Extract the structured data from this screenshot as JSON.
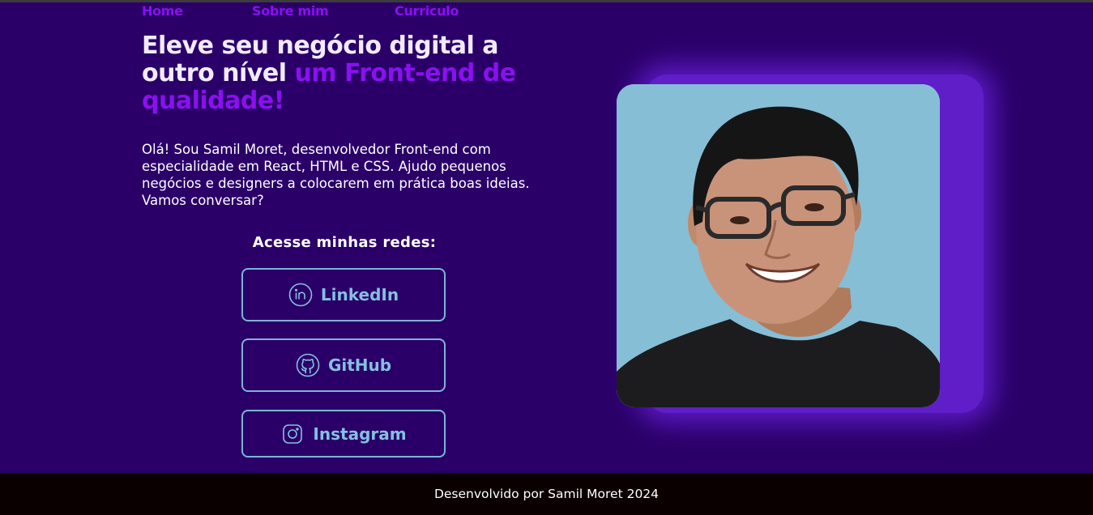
{
  "nav": {
    "items": [
      {
        "label": "Home"
      },
      {
        "label": "Sobre mim"
      },
      {
        "label": "Curriculo"
      }
    ]
  },
  "hero": {
    "headline_main": "Eleve seu negócio digital a outro nível ",
    "headline_accent": "um Front-end de qualidade!",
    "intro": "Olá! Sou Samil Moret, desenvolvedor Front-end com especialidade em React, HTML e CSS. Ajudo pequenos negócios e designers a colocarem em prática boas ideias. Vamos conversar?"
  },
  "social": {
    "title": "Acesse minhas redes:",
    "links": [
      {
        "label": "LinkedIn",
        "icon": "linkedin-icon"
      },
      {
        "label": "GitHub",
        "icon": "github-icon"
      },
      {
        "label": "Instagram",
        "icon": "instagram-icon"
      }
    ]
  },
  "footer": {
    "text": "Desenvolvido por Samil Moret 2024"
  },
  "colors": {
    "background": "#2a0068",
    "accent": "#8a10f0",
    "button_border": "#7fb3d5",
    "footer_bg": "#0a0000"
  }
}
